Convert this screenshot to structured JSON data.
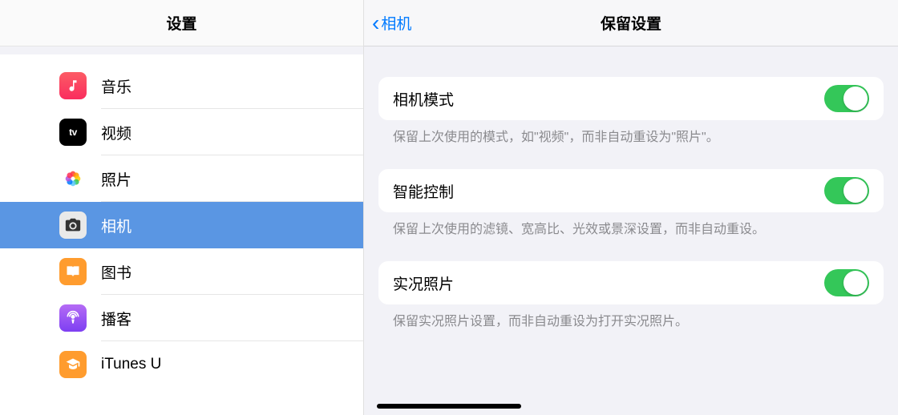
{
  "sidebar": {
    "title": "设置",
    "items": [
      {
        "id": "music",
        "label": "音乐"
      },
      {
        "id": "video",
        "label": "视频"
      },
      {
        "id": "photos",
        "label": "照片"
      },
      {
        "id": "camera",
        "label": "相机",
        "selected": true
      },
      {
        "id": "books",
        "label": "图书"
      },
      {
        "id": "podcast",
        "label": "播客"
      },
      {
        "id": "itunesu",
        "label": "iTunes U"
      }
    ]
  },
  "detail": {
    "back_label": "相机",
    "title": "保留设置",
    "groups": [
      {
        "id": "camera-mode",
        "label": "相机模式",
        "desc": "保留上次使用的模式，如\"视频\"，而非自动重设为\"照片\"。",
        "on": true
      },
      {
        "id": "smart-controls",
        "label": "智能控制",
        "desc": "保留上次使用的滤镜、宽高比、光效或景深设置，而非自动重设。",
        "on": true
      },
      {
        "id": "live-photo",
        "label": "实况照片",
        "desc": "保留实况照片设置，而非自动重设为打开实况照片。",
        "on": true
      }
    ]
  }
}
